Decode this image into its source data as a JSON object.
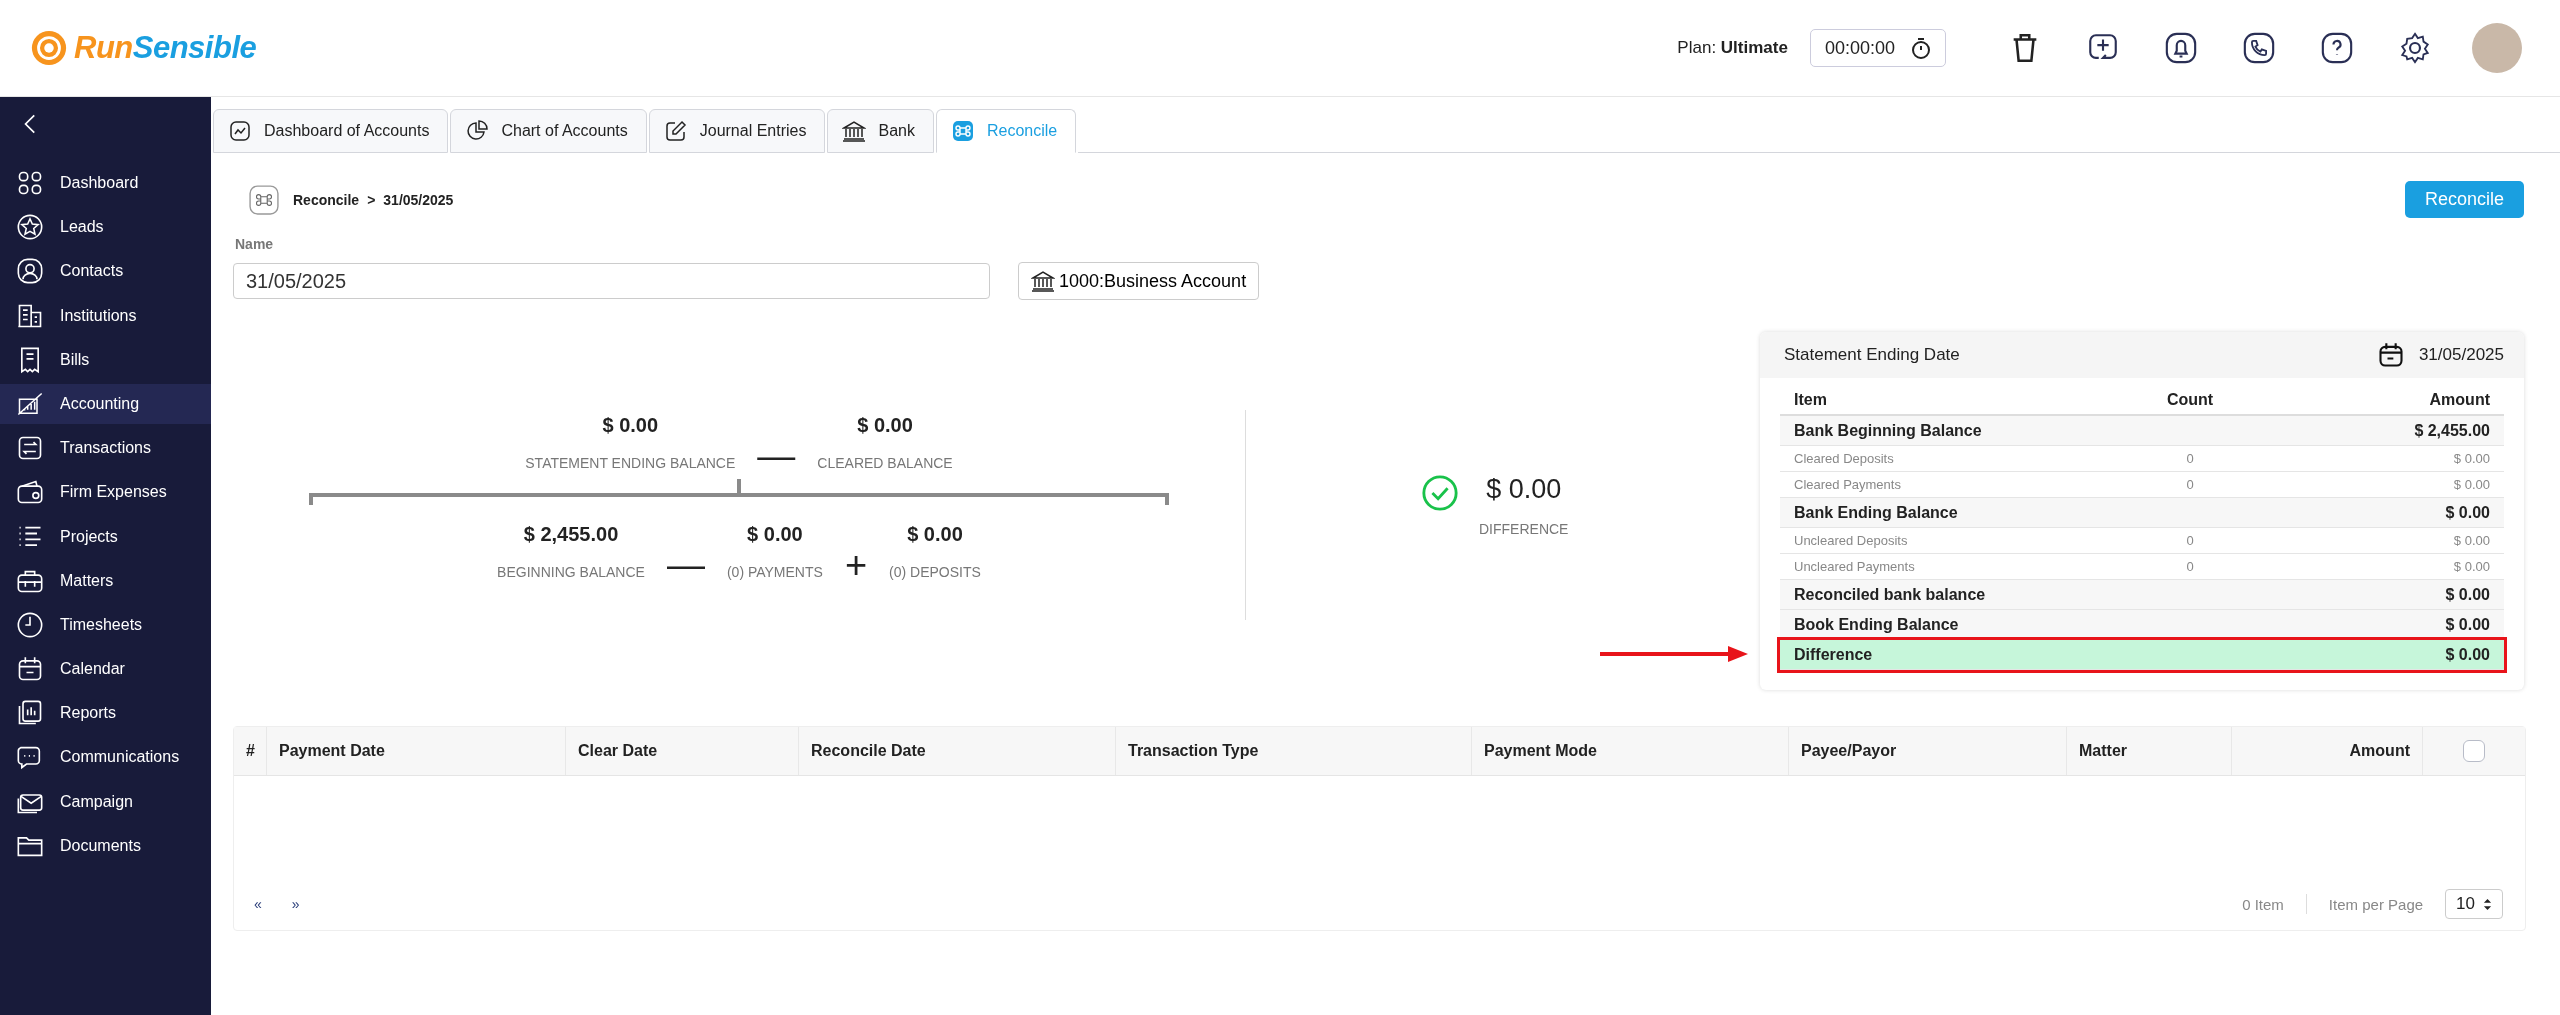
{
  "header": {
    "logo": [
      {
        "text": "Run",
        "color": "#f7941d"
      },
      {
        "text": "Sensible",
        "color": "#1a9fe0"
      }
    ],
    "plan_label": "Plan:",
    "plan": "Ultimate",
    "timer": "00:00:00"
  },
  "sidebar": {
    "items": [
      {
        "label": "Dashboard",
        "selected": false
      },
      {
        "label": "Leads",
        "selected": false
      },
      {
        "label": "Contacts",
        "selected": false
      },
      {
        "label": "Institutions",
        "selected": false
      },
      {
        "label": "Bills",
        "selected": false
      },
      {
        "label": "Accounting",
        "selected": true
      },
      {
        "label": "Transactions",
        "selected": false
      },
      {
        "label": "Firm Expenses",
        "selected": false
      },
      {
        "label": "Projects",
        "selected": false
      },
      {
        "label": "Matters",
        "selected": false
      },
      {
        "label": "Timesheets",
        "selected": false
      },
      {
        "label": "Calendar",
        "selected": false
      },
      {
        "label": "Reports",
        "selected": false
      },
      {
        "label": "Communications",
        "selected": false
      },
      {
        "label": "Campaign",
        "selected": false
      },
      {
        "label": "Documents",
        "selected": false
      }
    ]
  },
  "tabs": [
    {
      "label": "Dashboard of Accounts",
      "selected": false
    },
    {
      "label": "Chart of Accounts",
      "selected": false
    },
    {
      "label": "Journal Entries",
      "selected": false
    },
    {
      "label": "Bank",
      "selected": false
    },
    {
      "label": "Reconcile",
      "selected": true
    }
  ],
  "breadcrumb": {
    "root": "Reconcile",
    "separator": ">",
    "current": "31/05/2025"
  },
  "reconcile_button": "Reconcile",
  "name_field": {
    "label": "Name",
    "value": "31/05/2025"
  },
  "account_button": "1000:Business Account",
  "formula": {
    "top": [
      {
        "value": "$ 0.00",
        "label": "STATEMENT ENDING BALANCE"
      },
      {
        "value": "$ 0.00",
        "label": "CLEARED BALANCE"
      }
    ],
    "top_ops": [
      "—"
    ],
    "bottom": [
      {
        "value": "$ 2,455.00",
        "label": "BEGINNING BALANCE"
      },
      {
        "value": "$ 0.00",
        "label": "(0) PAYMENTS"
      },
      {
        "value": "$ 0.00",
        "label": "(0) DEPOSITS"
      }
    ],
    "bottom_ops": [
      "—",
      "+"
    ]
  },
  "difference": {
    "value": "$ 0.00",
    "label": "DIFFERENCE"
  },
  "summary": {
    "title": "Statement Ending Date",
    "date": "31/05/2025",
    "columns": [
      "Item",
      "Count",
      "Amount"
    ],
    "rows": [
      {
        "kind": "total",
        "item": "Bank Beginning Balance",
        "amount": "$ 2,455.00",
        "highlighted": false
      },
      {
        "kind": "detail",
        "item": "Cleared Deposits",
        "count": "0",
        "amount": "$ 0.00",
        "highlighted": false
      },
      {
        "kind": "detail",
        "item": "Cleared Payments",
        "count": "0",
        "amount": "$ 0.00",
        "highlighted": false
      },
      {
        "kind": "total",
        "item": "Bank Ending Balance",
        "amount": "$ 0.00",
        "highlighted": false
      },
      {
        "kind": "detail",
        "item": "Uncleared Deposits",
        "count": "0",
        "amount": "$ 0.00",
        "highlighted": false
      },
      {
        "kind": "detail",
        "item": "Uncleared Payments",
        "count": "0",
        "amount": "$ 0.00",
        "highlighted": false
      },
      {
        "kind": "total",
        "item": "Reconciled bank balance",
        "amount": "$ 0.00",
        "highlighted": false
      },
      {
        "kind": "total",
        "item": "Book Ending Balance",
        "amount": "$ 0.00",
        "highlighted": false
      },
      {
        "kind": "total",
        "item": "Difference",
        "amount": "$ 0.00",
        "highlighted": true
      }
    ]
  },
  "table": {
    "columns": [
      "#",
      "Payment Date",
      "Clear Date",
      "Reconcile Date",
      "Transaction Type",
      "Payment Mode",
      "Payee/Payor",
      "Matter",
      "Amount"
    ],
    "select_all_checked": false,
    "prev": "«",
    "next": "»",
    "item_count": "0 Item",
    "per_page_label": "Item per Page",
    "per_page": "10"
  }
}
